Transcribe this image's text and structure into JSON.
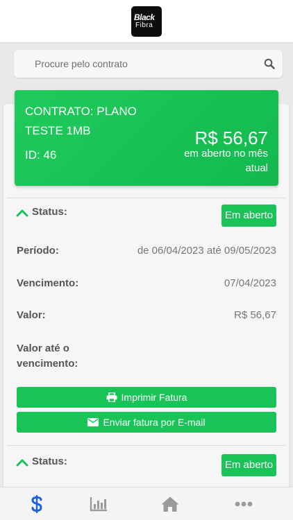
{
  "header": {
    "logo_line1": "Black",
    "logo_line2": "Fibra"
  },
  "search": {
    "placeholder": "Procure pelo contrato",
    "icon": "search-icon"
  },
  "contract": {
    "name": "CONTRATO: PLANO TESTE 1MB",
    "id_text": "ID: 46",
    "amount": "R$ 56,67",
    "amount_note": "em aberto no mês atual"
  },
  "invoices": [
    {
      "status_label": "Status:",
      "status_value": "Em aberto",
      "period_label": "Período:",
      "period_value": "de 06/04/2023 até 09/05/2023",
      "due_label": "Vencimento:",
      "due_value": "07/04/2023",
      "value_label": "Valor:",
      "value_value": "R$ 56,67",
      "value_until_due_label": "Valor até o vencimento:",
      "print_button": "Imprimir Fatura",
      "email_button": "Enviar fatura por E-mail"
    },
    {
      "status_label": "Status:",
      "status_value": "Em aberto"
    }
  ],
  "tabbar": {
    "items": [
      {
        "icon": "dollar-icon",
        "active": true
      },
      {
        "icon": "bar-chart-icon",
        "active": false
      },
      {
        "icon": "home-icon",
        "active": false
      },
      {
        "icon": "more-icon",
        "active": false
      }
    ]
  },
  "colors": {
    "accent": "#19c358",
    "tab_active": "#1b5fe0",
    "tab_inactive": "#9a9a9a"
  }
}
